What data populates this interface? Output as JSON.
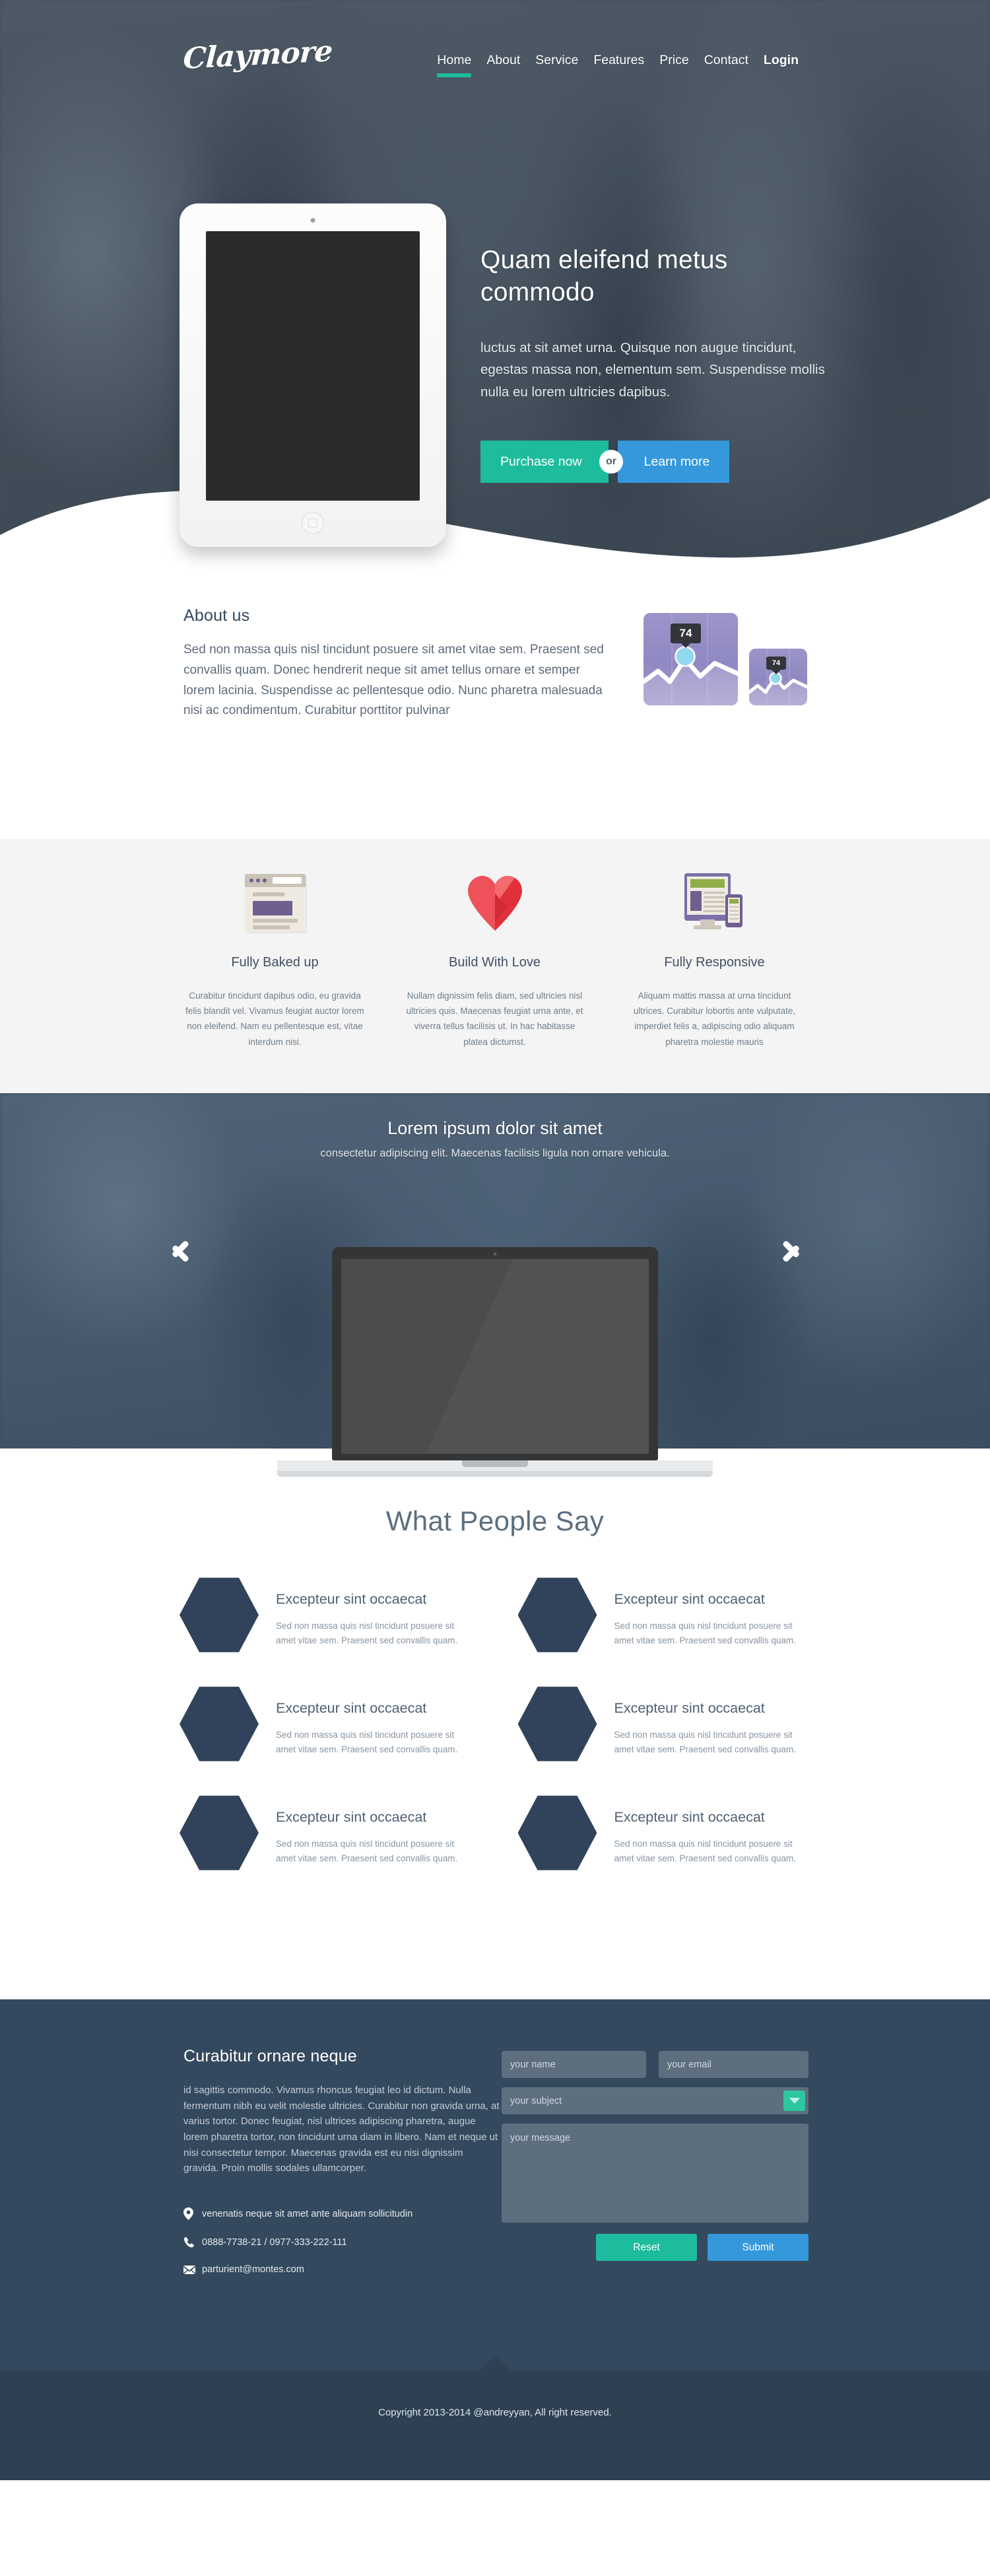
{
  "brand": {
    "logo": "Claymore"
  },
  "nav": {
    "items": [
      {
        "label": "Home",
        "active": true,
        "bold": false
      },
      {
        "label": "About",
        "active": false,
        "bold": false
      },
      {
        "label": "Service",
        "active": false,
        "bold": false
      },
      {
        "label": "Features",
        "active": false,
        "bold": false
      },
      {
        "label": "Price",
        "active": false,
        "bold": false
      },
      {
        "label": "Contact",
        "active": false,
        "bold": false
      },
      {
        "label": "Login",
        "active": false,
        "bold": true
      }
    ]
  },
  "hero": {
    "title": "Quam eleifend metus commodo",
    "text": "luctus at sit amet urna. Quisque non augue tincidunt, egestas massa non, elementum sem. Suspendisse mollis nulla eu lorem ultricies dapibus.",
    "primary_button": "Purchase now",
    "or_label": "or",
    "secondary_button": "Learn more"
  },
  "about": {
    "title": "About us",
    "text": "Sed non massa quis nisl tincidunt posuere sit amet vitae sem. Praesent sed convallis quam. Donec hendrerit neque sit amet tellus ornare et semper lorem lacinia. Suspendisse ac pellentesque odio. Nunc pharetra malesuada nisi ac condimentum. Curabitur porttitor pulvinar",
    "chart_big_value": "74",
    "chart_small_value": "74"
  },
  "features": [
    {
      "icon": "browser-icon",
      "title": "Fully Baked up",
      "text": "Curabitur tincidunt dapibus odio, eu gravida felis blandit vel. Vivamus feugiat auctor lorem non eleifend. Nam eu pellentesque est, vitae interdum nisi."
    },
    {
      "icon": "heart-icon",
      "title": "Build With Love",
      "text": "Nullam dignissim felis diam, sed ultricies nisl ultricies quis. Maecenas feugiat urna ante, et viverra tellus facilisis ut. In hac habitasse platea dictumst."
    },
    {
      "icon": "responsive-devices-icon",
      "title": "Fully Responsive",
      "text": "Aliquam mattis massa at urna tincidunt ultrices. Curabitur lobortis ante vulputate, imperdiet felis a, adipiscing odio aliquam pharetra molestie mauris"
    }
  ],
  "carousel": {
    "title": "Lorem ipsum dolor sit amet",
    "subtitle": "consectetur adipiscing elit. Maecenas facilisis ligula non ornare vehicula.",
    "prev_label": "Previous slide",
    "next_label": "Next slide"
  },
  "testimonials": {
    "heading": "What People Say",
    "items": [
      {
        "name": "Excepteur sint occaecat",
        "text": "Sed non massa quis nisl tincidunt posuere sit amet vitae sem. Praesent sed convallis quam."
      },
      {
        "name": "Excepteur sint occaecat",
        "text": "Sed non massa quis nisl tincidunt posuere sit amet vitae sem. Praesent sed convallis quam."
      },
      {
        "name": "Excepteur sint occaecat",
        "text": "Sed non massa quis nisl tincidunt posuere sit amet vitae sem. Praesent sed convallis quam."
      },
      {
        "name": "Excepteur sint occaecat",
        "text": "Sed non massa quis nisl tincidunt posuere sit amet vitae sem. Praesent sed convallis quam."
      },
      {
        "name": "Excepteur sint occaecat",
        "text": "Sed non massa quis nisl tincidunt posuere sit amet vitae sem. Praesent sed convallis quam."
      },
      {
        "name": "Excepteur sint occaecat",
        "text": "Sed non massa quis nisl tincidunt posuere sit amet vitae sem. Praesent sed convallis quam."
      }
    ]
  },
  "footer": {
    "title": "Curabitur ornare neque",
    "text": "id sagittis commodo. Vivamus rhoncus feugiat leo id dictum. Nulla fermentum nibh eu velit molestie ultricies. Curabitur non gravida urna, at varius tortor. Donec feugiat, nisl ultrices adipiscing pharetra, augue lorem pharetra tortor, non tincidunt urna diam in libero. Nam et neque ut nisi consectetur tempor. Maecenas gravida est eu nisi dignissim gravida. Proin mollis sodales ullamcorper.",
    "address": "venenatis neque sit amet ante aliquam sollicitudin",
    "phone": "0888-7738-21  /  0977-333-222-111",
    "email": "parturient@montes.com",
    "form": {
      "name_placeholder": "your name",
      "email_placeholder": "your email",
      "subject_placeholder": "your subject",
      "message_placeholder": "your message",
      "reset_label": "Reset",
      "submit_label": "Submit"
    },
    "copyright": "Copyright 2013-2014 @andreyyan, All right reserved."
  },
  "colors": {
    "accent_green": "#1dbc9c",
    "accent_blue": "#3498db",
    "dark_navy": "#34495e",
    "copy_navy": "#2d4152",
    "hex_navy": "#30435a",
    "chart_purple": "#8f88c2",
    "heart_red": "#e8414a"
  }
}
